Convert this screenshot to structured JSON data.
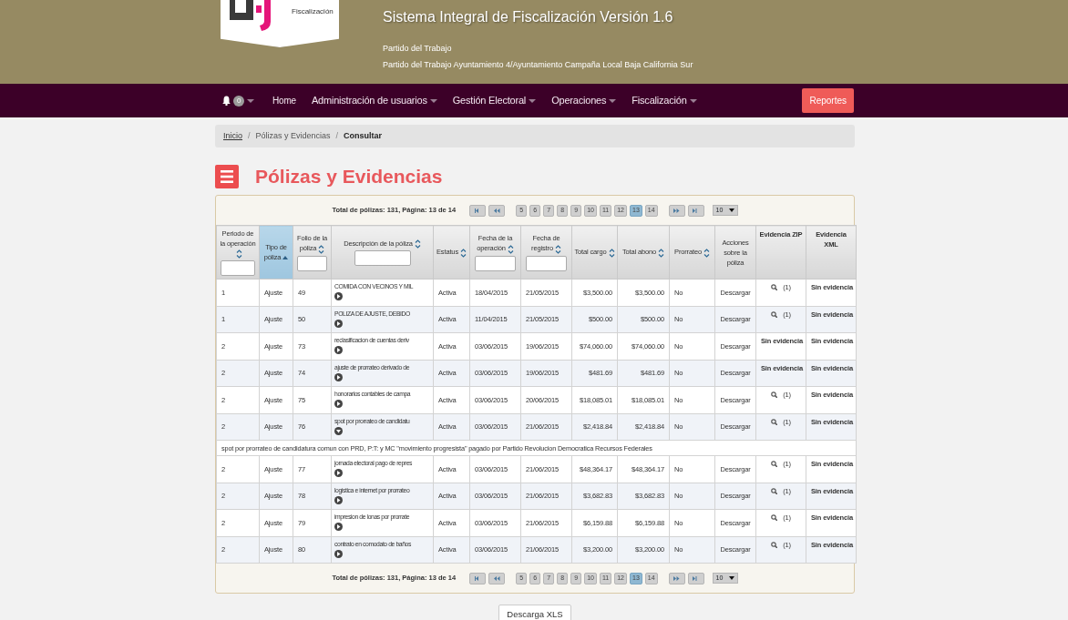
{
  "header": {
    "logo_text": "Fiscalización",
    "title": "Sistema Integral de Fiscalización Versión 1.6",
    "party": "Partido del Trabajo",
    "subtitle": "Partido del Trabajo Ayuntamiento 4/Ayuntamiento Campaña Local Baja California Sur"
  },
  "navbar": {
    "notifications": "0",
    "items": [
      {
        "label": "Home",
        "dropdown": false
      },
      {
        "label": "Administración de usuarios",
        "dropdown": true
      },
      {
        "label": "Gestión Electoral",
        "dropdown": true
      },
      {
        "label": "Operaciones",
        "dropdown": true
      },
      {
        "label": "Fiscalización",
        "dropdown": true
      }
    ],
    "reports_button": "Reportes"
  },
  "breadcrumb_separator": "/",
  "breadcrumb": [
    {
      "label": "Inicio",
      "kind": "link"
    },
    {
      "label": "Pólizas y Evidencias",
      "kind": "text"
    },
    {
      "label": "Consultar",
      "kind": "current"
    }
  ],
  "page_title": "Pólizas y Evidencias",
  "pager_top": {
    "summary": "Total de pólizas: 131, Página: 13 de 14",
    "page_size": "10",
    "pages": [
      {
        "label": "5",
        "selected": false
      },
      {
        "label": "6",
        "selected": false
      },
      {
        "label": "7",
        "selected": false
      },
      {
        "label": "8",
        "selected": false
      },
      {
        "label": "9",
        "selected": false
      },
      {
        "label": "10",
        "selected": false
      },
      {
        "label": "11",
        "selected": false
      },
      {
        "label": "12",
        "selected": false
      },
      {
        "label": "13",
        "selected": true
      },
      {
        "label": "14",
        "selected": false
      }
    ]
  },
  "table": {
    "columns": [
      {
        "label": "Periodo de la operación",
        "sortable": true,
        "sorted": false,
        "filter": true
      },
      {
        "label": "Tipo de póliza",
        "sortable": true,
        "sorted": true,
        "filter": false
      },
      {
        "label": "Folio de la póliza",
        "sortable": true,
        "sorted": false,
        "filter": true
      },
      {
        "label": "Descripción de la póliza",
        "sortable": true,
        "sorted": false,
        "filter": true
      },
      {
        "label": "Estatus",
        "sortable": true,
        "sorted": false,
        "filter": false
      },
      {
        "label": "Fecha de la operación",
        "sortable": true,
        "sorted": false,
        "filter": true
      },
      {
        "label": "Fecha de registro",
        "sortable": true,
        "sorted": false,
        "filter": true
      },
      {
        "label": "Total cargo",
        "sortable": true,
        "sorted": false,
        "filter": false
      },
      {
        "label": "Total abono",
        "sortable": true,
        "sorted": false,
        "filter": false
      },
      {
        "label": "Prorrateo",
        "sortable": true,
        "sorted": false,
        "filter": false
      },
      {
        "label": "Acciones sobre la póliza",
        "sortable": false,
        "sorted": false,
        "filter": false
      },
      {
        "label": "Evidencia ZIP",
        "sortable": false,
        "sorted": false,
        "filter": false
      },
      {
        "label": "Evidencia XML",
        "sortable": false,
        "sorted": false,
        "filter": false
      }
    ],
    "rows": [
      {
        "periodo": "1",
        "tipo": "Ajuste",
        "folio": "49",
        "descripcion": "COMIDA CON VECINOS Y MIL",
        "expanded": false,
        "estatus": "Activa",
        "fecha_operacion": "18/04/2015",
        "fecha_registro": "21/05/2015",
        "total_cargo": "$3,500.00",
        "total_abono": "$3,500.00",
        "prorrateo": "No",
        "accion": "Descargar",
        "zip": {
          "kind": "link",
          "count": "(1)"
        },
        "xml": "Sin evidencia"
      },
      {
        "periodo": "1",
        "tipo": "Ajuste",
        "folio": "50",
        "descripcion": "POLIZA DE AJUSTE, DEBIDO",
        "expanded": false,
        "estatus": "Activa",
        "fecha_operacion": "11/04/2015",
        "fecha_registro": "21/05/2015",
        "total_cargo": "$500.00",
        "total_abono": "$500.00",
        "prorrateo": "No",
        "accion": "Descargar",
        "zip": {
          "kind": "link",
          "count": "(1)"
        },
        "xml": "Sin evidencia"
      },
      {
        "periodo": "2",
        "tipo": "Ajuste",
        "folio": "73",
        "descripcion": "reclasificacion de cuentas deriv",
        "expanded": false,
        "estatus": "Activa",
        "fecha_operacion": "03/06/2015",
        "fecha_registro": "19/06/2015",
        "total_cargo": "$74,060.00",
        "total_abono": "$74,060.00",
        "prorrateo": "No",
        "accion": "Descargar",
        "zip": {
          "kind": "text",
          "label": "Sin evidencia"
        },
        "xml": "Sin evidencia"
      },
      {
        "periodo": "2",
        "tipo": "Ajuste",
        "folio": "74",
        "descripcion": "ajuste de prorrateo derivado de",
        "expanded": false,
        "estatus": "Activa",
        "fecha_operacion": "03/06/2015",
        "fecha_registro": "19/06/2015",
        "total_cargo": "$481.69",
        "total_abono": "$481.69",
        "prorrateo": "No",
        "accion": "Descargar",
        "zip": {
          "kind": "text",
          "label": "Sin evidencia"
        },
        "xml": "Sin evidencia"
      },
      {
        "periodo": "2",
        "tipo": "Ajuste",
        "folio": "75",
        "descripcion": "honorarios contables de campa",
        "expanded": false,
        "estatus": "Activa",
        "fecha_operacion": "03/06/2015",
        "fecha_registro": "20/06/2015",
        "total_cargo": "$18,085.01",
        "total_abono": "$18,085.01",
        "prorrateo": "No",
        "accion": "Descargar",
        "zip": {
          "kind": "link",
          "count": "(1)"
        },
        "xml": "Sin evidencia"
      },
      {
        "periodo": "2",
        "tipo": "Ajuste",
        "folio": "76",
        "descripcion": "spot por prorrateo de candidatu",
        "expanded": true,
        "detail": "spot por prorrateo de candidatura comun con PRD, P:T: y MC \"movimiento progresista\" pagado por Partido Revolucion Democratica Recursos Federales",
        "estatus": "Activa",
        "fecha_operacion": "03/06/2015",
        "fecha_registro": "21/06/2015",
        "total_cargo": "$2,418.84",
        "total_abono": "$2,418.84",
        "prorrateo": "No",
        "accion": "Descargar",
        "zip": {
          "kind": "link",
          "count": "(1)"
        },
        "xml": "Sin evidencia"
      },
      {
        "periodo": "2",
        "tipo": "Ajuste",
        "folio": "77",
        "descripcion": "jornada electoral pago de repres",
        "expanded": false,
        "estatus": "Activa",
        "fecha_operacion": "03/06/2015",
        "fecha_registro": "21/06/2015",
        "total_cargo": "$48,364.17",
        "total_abono": "$48,364.17",
        "prorrateo": "No",
        "accion": "Descargar",
        "zip": {
          "kind": "link",
          "count": "(1)"
        },
        "xml": "Sin evidencia"
      },
      {
        "periodo": "2",
        "tipo": "Ajuste",
        "folio": "78",
        "descripcion": "logistica e internet por prorrateo",
        "expanded": false,
        "estatus": "Activa",
        "fecha_operacion": "03/06/2015",
        "fecha_registro": "21/06/2015",
        "total_cargo": "$3,682.83",
        "total_abono": "$3,682.83",
        "prorrateo": "No",
        "accion": "Descargar",
        "zip": {
          "kind": "link",
          "count": "(1)"
        },
        "xml": "Sin evidencia"
      },
      {
        "periodo": "2",
        "tipo": "Ajuste",
        "folio": "79",
        "descripcion": "impresion de lonas por prorrate",
        "expanded": false,
        "estatus": "Activa",
        "fecha_operacion": "03/06/2015",
        "fecha_registro": "21/06/2015",
        "total_cargo": "$6,159.88",
        "total_abono": "$6,159.88",
        "prorrateo": "No",
        "accion": "Descargar",
        "zip": {
          "kind": "link",
          "count": "(1)"
        },
        "xml": "Sin evidencia"
      },
      {
        "periodo": "2",
        "tipo": "Ajuste",
        "folio": "80",
        "descripcion": "contrato en comodato de baños",
        "expanded": false,
        "estatus": "Activa",
        "fecha_operacion": "03/06/2015",
        "fecha_registro": "21/06/2015",
        "total_cargo": "$3,200.00",
        "total_abono": "$3,200.00",
        "prorrateo": "No",
        "accion": "Descargar",
        "zip": {
          "kind": "link",
          "count": "(1)"
        },
        "xml": "Sin evidencia"
      }
    ]
  },
  "pager_bottom": {
    "summary": "Total de pólizas: 131, Página: 13 de 14",
    "page_size": "10",
    "pages": [
      {
        "label": "5",
        "selected": false
      },
      {
        "label": "6",
        "selected": false
      },
      {
        "label": "7",
        "selected": false
      },
      {
        "label": "8",
        "selected": false
      },
      {
        "label": "9",
        "selected": false
      },
      {
        "label": "10",
        "selected": false
      },
      {
        "label": "11",
        "selected": false
      },
      {
        "label": "12",
        "selected": false
      },
      {
        "label": "13",
        "selected": true
      },
      {
        "label": "14",
        "selected": false
      }
    ]
  },
  "download_button": "Descarga XLS"
}
